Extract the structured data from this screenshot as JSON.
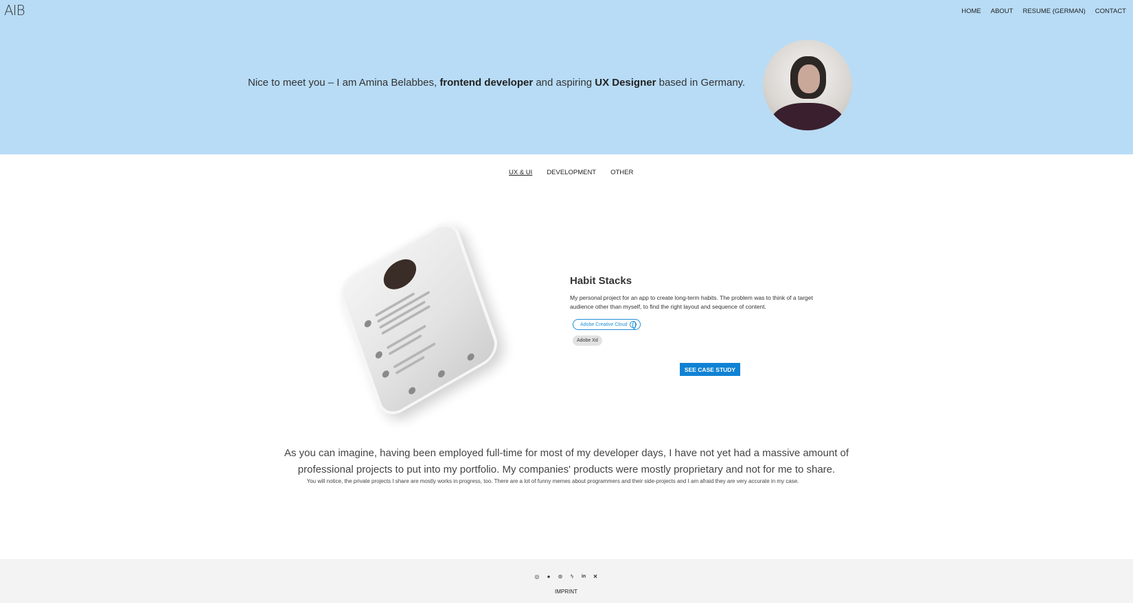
{
  "header": {
    "logo": "AIB",
    "nav": [
      "HOME",
      "ABOUT",
      "RESUME (GERMAN)",
      "CONTACT"
    ]
  },
  "hero": {
    "intro_pre": "Nice to meet you – I am Amina Belabbes, ",
    "intro_bold1": "frontend developer",
    "intro_mid": " and aspiring ",
    "intro_bold2": "UX Designer",
    "intro_post": " based in Germany."
  },
  "tabs": [
    {
      "label": "UX & UI",
      "active": true
    },
    {
      "label": "DEVELOPMENT",
      "active": false
    },
    {
      "label": "OTHER",
      "active": false
    }
  ],
  "project": {
    "title": "Habit Stacks",
    "description": "My personal project for an app to create long-term habits. The problem was to think of a target audience other than myself, to find the right layout and sequence of content.",
    "tags": [
      "Adobe Creative Cloud",
      "Adobe Xd"
    ],
    "cta": "SEE CASE STUDY"
  },
  "statement": {
    "main": "As you can imagine, having been employed full-time for most of my developer days, I have not yet had a massive amount of professional projects to put into my portfolio. My companies' products were mostly proprietary and not for me to share.",
    "footnote": "You will notice, the private projects I share are mostly works in progress, too. There are a lot of funny memes about programmers and their side-projects and I am afraid they are very accurate in my case."
  },
  "footer": {
    "socials": [
      "instagram-icon",
      "github-icon",
      "dribbble-icon",
      "bolt-icon",
      "linkedin-icon",
      "xing-icon"
    ],
    "imprint": "IMPRINT"
  },
  "colors": {
    "hero_bg": "#b8dcf6",
    "accent": "#1082d4",
    "footer_bg": "#f3f3f3"
  }
}
